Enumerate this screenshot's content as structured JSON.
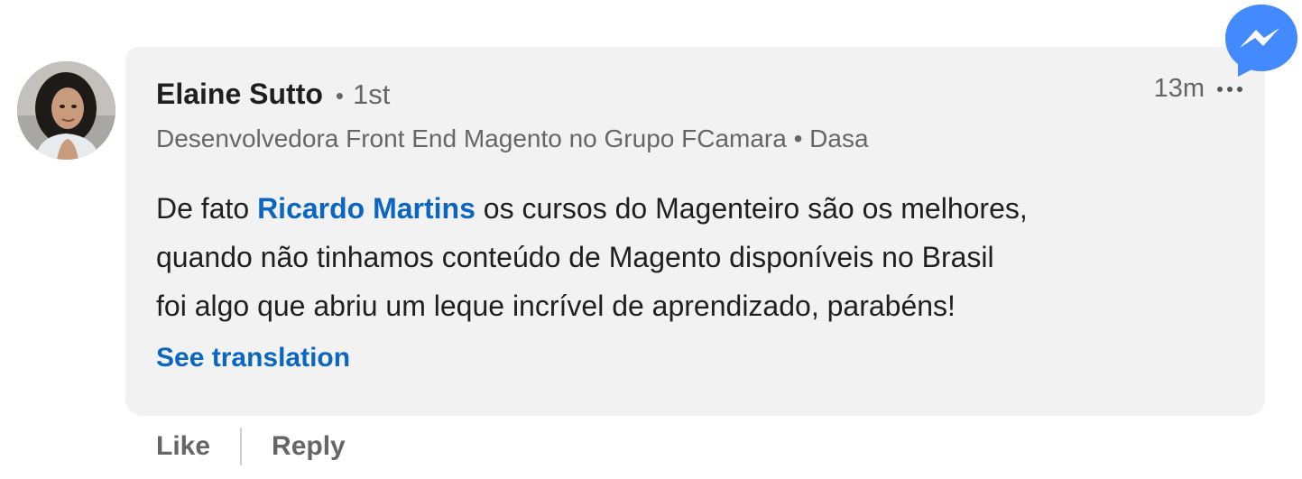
{
  "comment": {
    "author_name": "Elaine Sutto",
    "degree_separator": "•",
    "connection_degree": "1st",
    "headline": "Desenvolvedora Front End Magento no Grupo FCamara • Dasa",
    "timestamp": "13m",
    "more_options_icon": "ellipsis-icon",
    "body": {
      "line1_prefix": "De fato ",
      "mention": "Ricardo Martins",
      "line1_suffix": " os cursos do Magenteiro são os melhores,",
      "line2": "quando não tinhamos conteúdo de Magento disponíveis no Brasil",
      "line3": "foi algo que abriu um leque incrível de aprendizado, parabéns!"
    },
    "see_translation_label": "See translation"
  },
  "actions": {
    "like_label": "Like",
    "reply_label": "Reply"
  },
  "messenger": {
    "icon": "messenger-icon",
    "color": "#448aff"
  },
  "colors": {
    "link": "#0a66c2",
    "bubble": "#f2f2f2",
    "text_primary": "#1f1f1f",
    "text_secondary": "#666666"
  }
}
